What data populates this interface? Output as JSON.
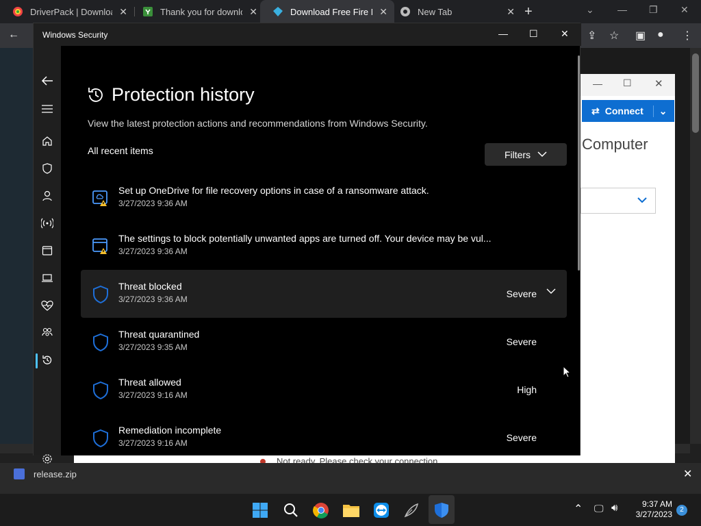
{
  "browser": {
    "tabs": [
      {
        "title": "DriverPack | Download"
      },
      {
        "title": "Thank you for download"
      },
      {
        "title": "Download Free Fire MA"
      },
      {
        "title": "New Tab"
      }
    ]
  },
  "teamviewer": {
    "connect_label": "Connect",
    "computer_label": "Computer",
    "status_text": "Not ready. Please check your connection"
  },
  "downloads": {
    "file": "release.zip"
  },
  "window": {
    "title": "Windows Security"
  },
  "page": {
    "title": "Protection history",
    "description": "View the latest protection actions and recommendations from Windows Security.",
    "section_label": "All recent items",
    "filters_label": "Filters"
  },
  "items": [
    {
      "title": "Set up OneDrive for file recovery options in case of a ransomware attack.",
      "date": "3/27/2023 9:36 AM",
      "severity": "",
      "icon": "onedrive-warning-icon"
    },
    {
      "title": "The settings to block potentially unwanted apps are turned off. Your device may be vul...",
      "date": "3/27/2023 9:36 AM",
      "severity": "",
      "icon": "app-warning-icon"
    },
    {
      "title": "Threat blocked",
      "date": "3/27/2023 9:36 AM",
      "severity": "Severe",
      "icon": "shield-icon"
    },
    {
      "title": "Threat quarantined",
      "date": "3/27/2023 9:35 AM",
      "severity": "Severe",
      "icon": "shield-icon"
    },
    {
      "title": "Threat allowed",
      "date": "3/27/2023 9:16 AM",
      "severity": "High",
      "icon": "shield-icon"
    },
    {
      "title": "Remediation incomplete",
      "date": "3/27/2023 9:16 AM",
      "severity": "Severe",
      "icon": "shield-icon"
    }
  ],
  "taskbar": {
    "time": "9:37 AM",
    "date": "3/27/2023",
    "notification_count": "2"
  },
  "colors": {
    "accent": "#4cc2ff",
    "shield": "#1e6fd9",
    "warning": "#f6c02e"
  }
}
